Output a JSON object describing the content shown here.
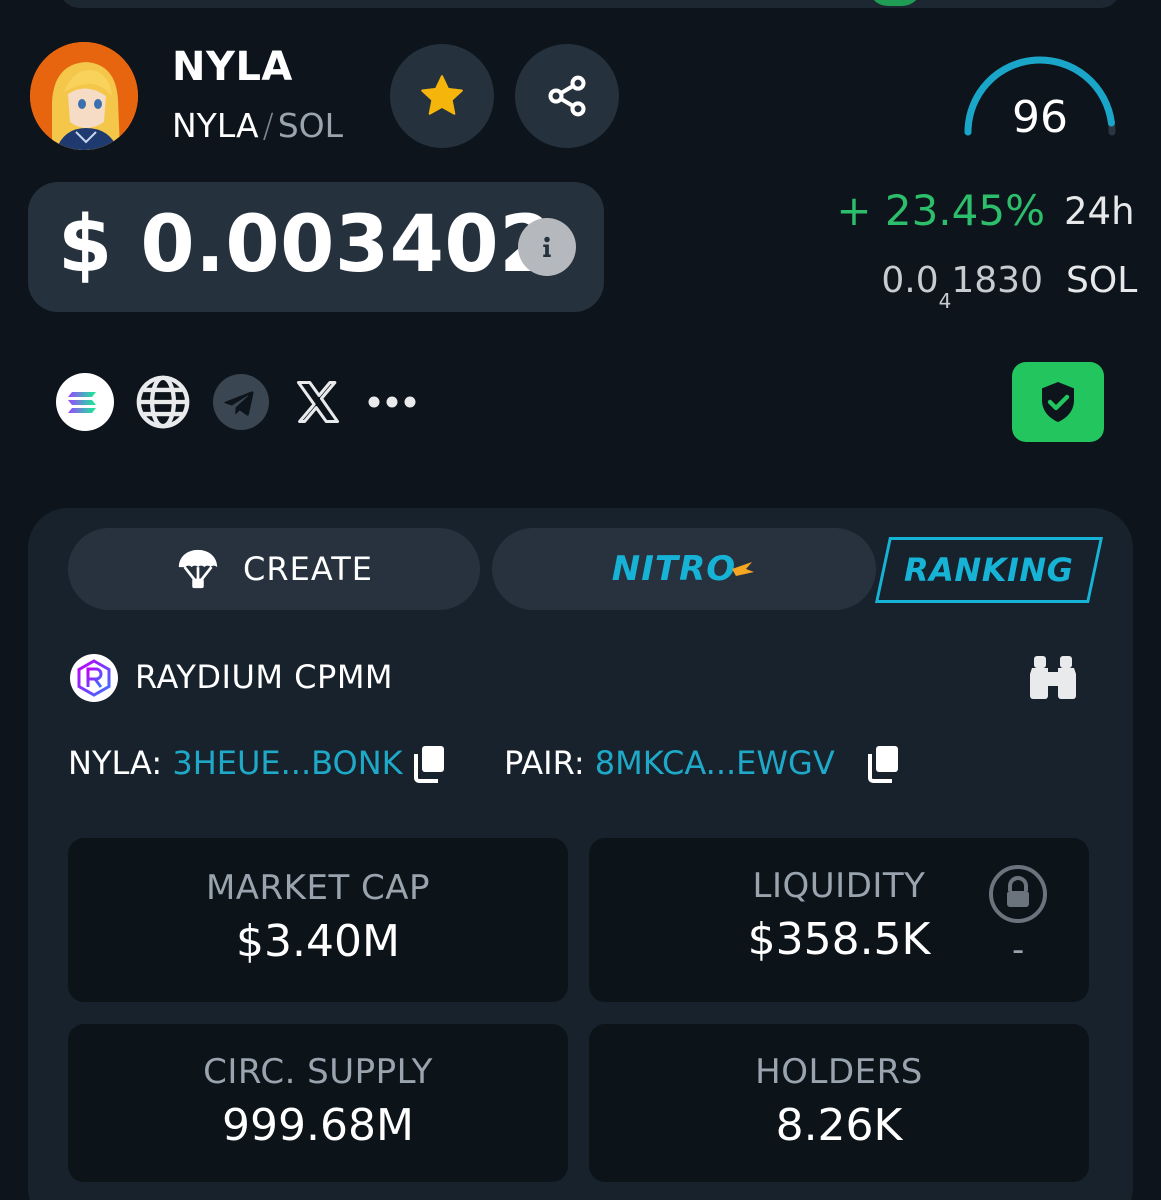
{
  "token": {
    "name": "NYLA",
    "base": "NYLA",
    "slash": "/",
    "quote": "SOL"
  },
  "score": {
    "value": "96",
    "fraction": 0.96
  },
  "price": {
    "usd": "$ 0.003402",
    "change": "+ 23.45%",
    "period": "24h",
    "sol_main": "0.0",
    "sol_sub": "4",
    "sol_rest": "1830",
    "sol_unit": "SOL"
  },
  "links": {
    "icons": [
      "solana-icon",
      "globe-icon",
      "telegram-icon",
      "x-icon",
      "more-icon",
      "shield-check-icon"
    ]
  },
  "tabs": {
    "create": "CREATE",
    "nitro": "NITRO",
    "ranking": "RANKING"
  },
  "dex": {
    "name": "RAYDIUM CPMM"
  },
  "addresses": {
    "token_key": "NYLA:",
    "token_value": "3HEUE...BONK",
    "pair_key": "PAIR:",
    "pair_value": "8MKCA...EWGV"
  },
  "stats": {
    "market_cap_label": "MARKET CAP",
    "market_cap_value": "$3.40M",
    "liquidity_label": "LIQUIDITY",
    "liquidity_value": "$358.5K",
    "liquidity_lock": "-",
    "supply_label": "CIRC. SUPPLY",
    "supply_value": "999.68M",
    "holders_label": "HOLDERS",
    "holders_value": "8.26K"
  },
  "colors": {
    "background": "#0d141b",
    "card": "#25313d",
    "accent": "#16b3d6",
    "positive": "#2dbe6c",
    "star": "#f5b50a",
    "shield": "#22c55e"
  }
}
